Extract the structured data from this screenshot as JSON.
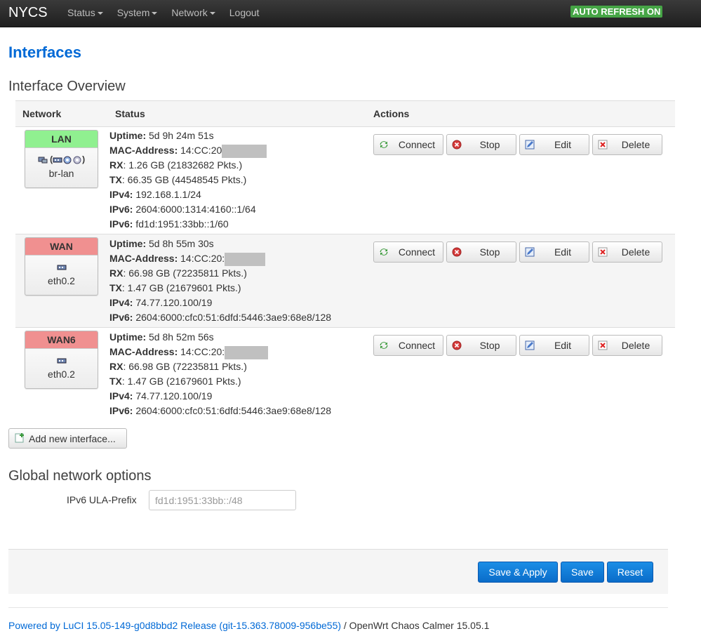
{
  "header": {
    "brand": "NYCS",
    "menu": [
      {
        "label": "Status"
      },
      {
        "label": "System"
      },
      {
        "label": "Network"
      },
      {
        "label": "Logout"
      }
    ],
    "auto_refresh": "AUTO REFRESH ON"
  },
  "page_title": "Interfaces",
  "overview": {
    "heading": "Interface Overview",
    "columns": {
      "network": "Network",
      "status": "Status",
      "actions": "Actions"
    },
    "interfaces": [
      {
        "name": "LAN",
        "device": "br-lan",
        "icons": "(• • •)",
        "uptime_label": "Uptime:",
        "uptime": " 5d 9h 24m 51s",
        "mac_label": "MAC-Address:",
        "mac": " 14:CC:20",
        "rx_label": "RX",
        "rx": ": 1.26 GB (21832682 Pkts.)",
        "tx_label": "TX",
        "tx": ": 66.35 GB (44548545 Pkts.)",
        "ipv4_label": "IPv4:",
        "ipv4": " 192.168.1.1/24",
        "ipv6_label": "IPv6:",
        "ipv6": " 2604:6000:1314:4160::1/64",
        "ipv6b_label": "IPv6:",
        "ipv6b": " fd1d:1951:33bb::1/60"
      },
      {
        "name": "WAN",
        "device": "eth0.2",
        "uptime_label": "Uptime:",
        "uptime": " 5d 8h 55m 30s",
        "mac_label": "MAC-Address:",
        "mac": " 14:CC:20:",
        "rx_label": "RX",
        "rx": ": 66.98 GB (72235811 Pkts.)",
        "tx_label": "TX",
        "tx": ": 1.47 GB (21679601 Pkts.)",
        "ipv4_label": "IPv4:",
        "ipv4": " 74.77.120.100/19",
        "ipv6_label": "IPv6:",
        "ipv6": " 2604:6000:cfc0:51:6dfd:5446:3ae9:68e8/128"
      },
      {
        "name": "WAN6",
        "device": "eth0.2",
        "uptime_label": "Uptime:",
        "uptime": " 5d 8h 52m 56s",
        "mac_label": "MAC-Address:",
        "mac": " 14:CC:20:",
        "rx_label": "RX",
        "rx": ": 66.98 GB (72235811 Pkts.)",
        "tx_label": "TX",
        "tx": ": 1.47 GB (21679601 Pkts.)",
        "ipv4_label": "IPv4:",
        "ipv4": " 74.77.120.100/19",
        "ipv6_label": "IPv6:",
        "ipv6": " 2604:6000:cfc0:51:6dfd:5446:3ae9:68e8/128"
      }
    ],
    "buttons": {
      "connect": "Connect",
      "stop": "Stop",
      "edit": "Edit",
      "delete": "Delete"
    },
    "add_interface": "Add new interface..."
  },
  "global": {
    "heading": "Global network options",
    "ula_label": "IPv6 ULA-Prefix",
    "ula_value": "fd1d:1951:33bb::/48"
  },
  "actionbar": {
    "save_apply": "Save & Apply",
    "save": "Save",
    "reset": "Reset"
  },
  "footer": {
    "link": "Powered by LuCI 15.05-149-g0d8bbd2 Release (git-15.363.78009-956be55)",
    "text": " / OpenWrt Chaos Calmer 15.05.1"
  },
  "colors": {
    "link": "#0069d6",
    "lan": "#90f090",
    "wan": "#f09090",
    "auto_refresh": "#46a546",
    "primary_button": "#0a6cc9"
  }
}
